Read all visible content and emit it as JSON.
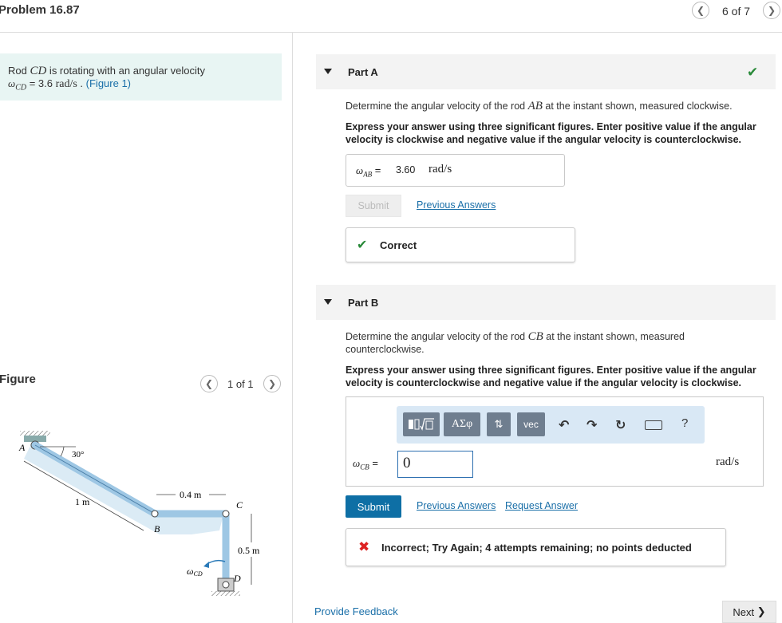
{
  "header": {
    "title": "Problem 16.87",
    "page_count": "6 of 7",
    "prev_icon": "chevron-left",
    "next_icon": "chevron-right"
  },
  "statement": {
    "text_before": "Rod ",
    "rod_var": "CD",
    "text_mid": " is rotating with an angular velocity",
    "omega_sym": "ω",
    "omega_sub": "CD",
    "eq": " = 3.6 ",
    "unit": "rad/s",
    "period": " . ",
    "figure_link": "(Figure 1)"
  },
  "figure_panel": {
    "label": "Figure",
    "count": "1 of 1"
  },
  "figure": {
    "angle": "30°",
    "label_a": "A",
    "label_b": "B",
    "label_c": "C",
    "label_d": "D",
    "dim_1": "1 m",
    "dim_04": "0.4 m",
    "dim_05": "0.5 m",
    "omega_sym": "ω",
    "omega_sub": "CD"
  },
  "partA": {
    "title": "Part A",
    "question_prefix": "Determine the angular velocity of the rod ",
    "question_var": "AB",
    "question_suffix": " at the instant shown, measured clockwise.",
    "instructions": "Express your answer using three significant figures. Enter positive value if the angular velocity is clockwise and negative value if the angular velocity is counterclockwise.",
    "answer_sym": "ω",
    "answer_sub": "AB",
    "answer_eq": " =",
    "answer_value": "3.60",
    "answer_unit": "rad/s",
    "submit_label": "Submit",
    "previous_answers": "Previous Answers",
    "result": "Correct"
  },
  "partB": {
    "title": "Part B",
    "question_prefix": "Determine the angular velocity of the rod ",
    "question_var": "CB",
    "question_suffix": " at the instant shown, measured counterclockwise.",
    "instructions": "Express your answer using three significant figures. Enter positive value if the angular velocity is counterclockwise and negative value if the angular velocity is clockwise.",
    "toolbar": {
      "greek": "ΑΣφ",
      "vec": "vec",
      "help": "?"
    },
    "answer_sym": "ω",
    "answer_sub": "CB",
    "answer_eq": " =",
    "input_value": "0",
    "answer_unit": "rad/s",
    "submit_label": "Submit",
    "previous_answers": "Previous Answers",
    "request_answer": "Request Answer",
    "result": "Incorrect; Try Again; 4 attempts remaining; no points deducted"
  },
  "footer": {
    "feedback": "Provide Feedback",
    "next": "Next"
  }
}
